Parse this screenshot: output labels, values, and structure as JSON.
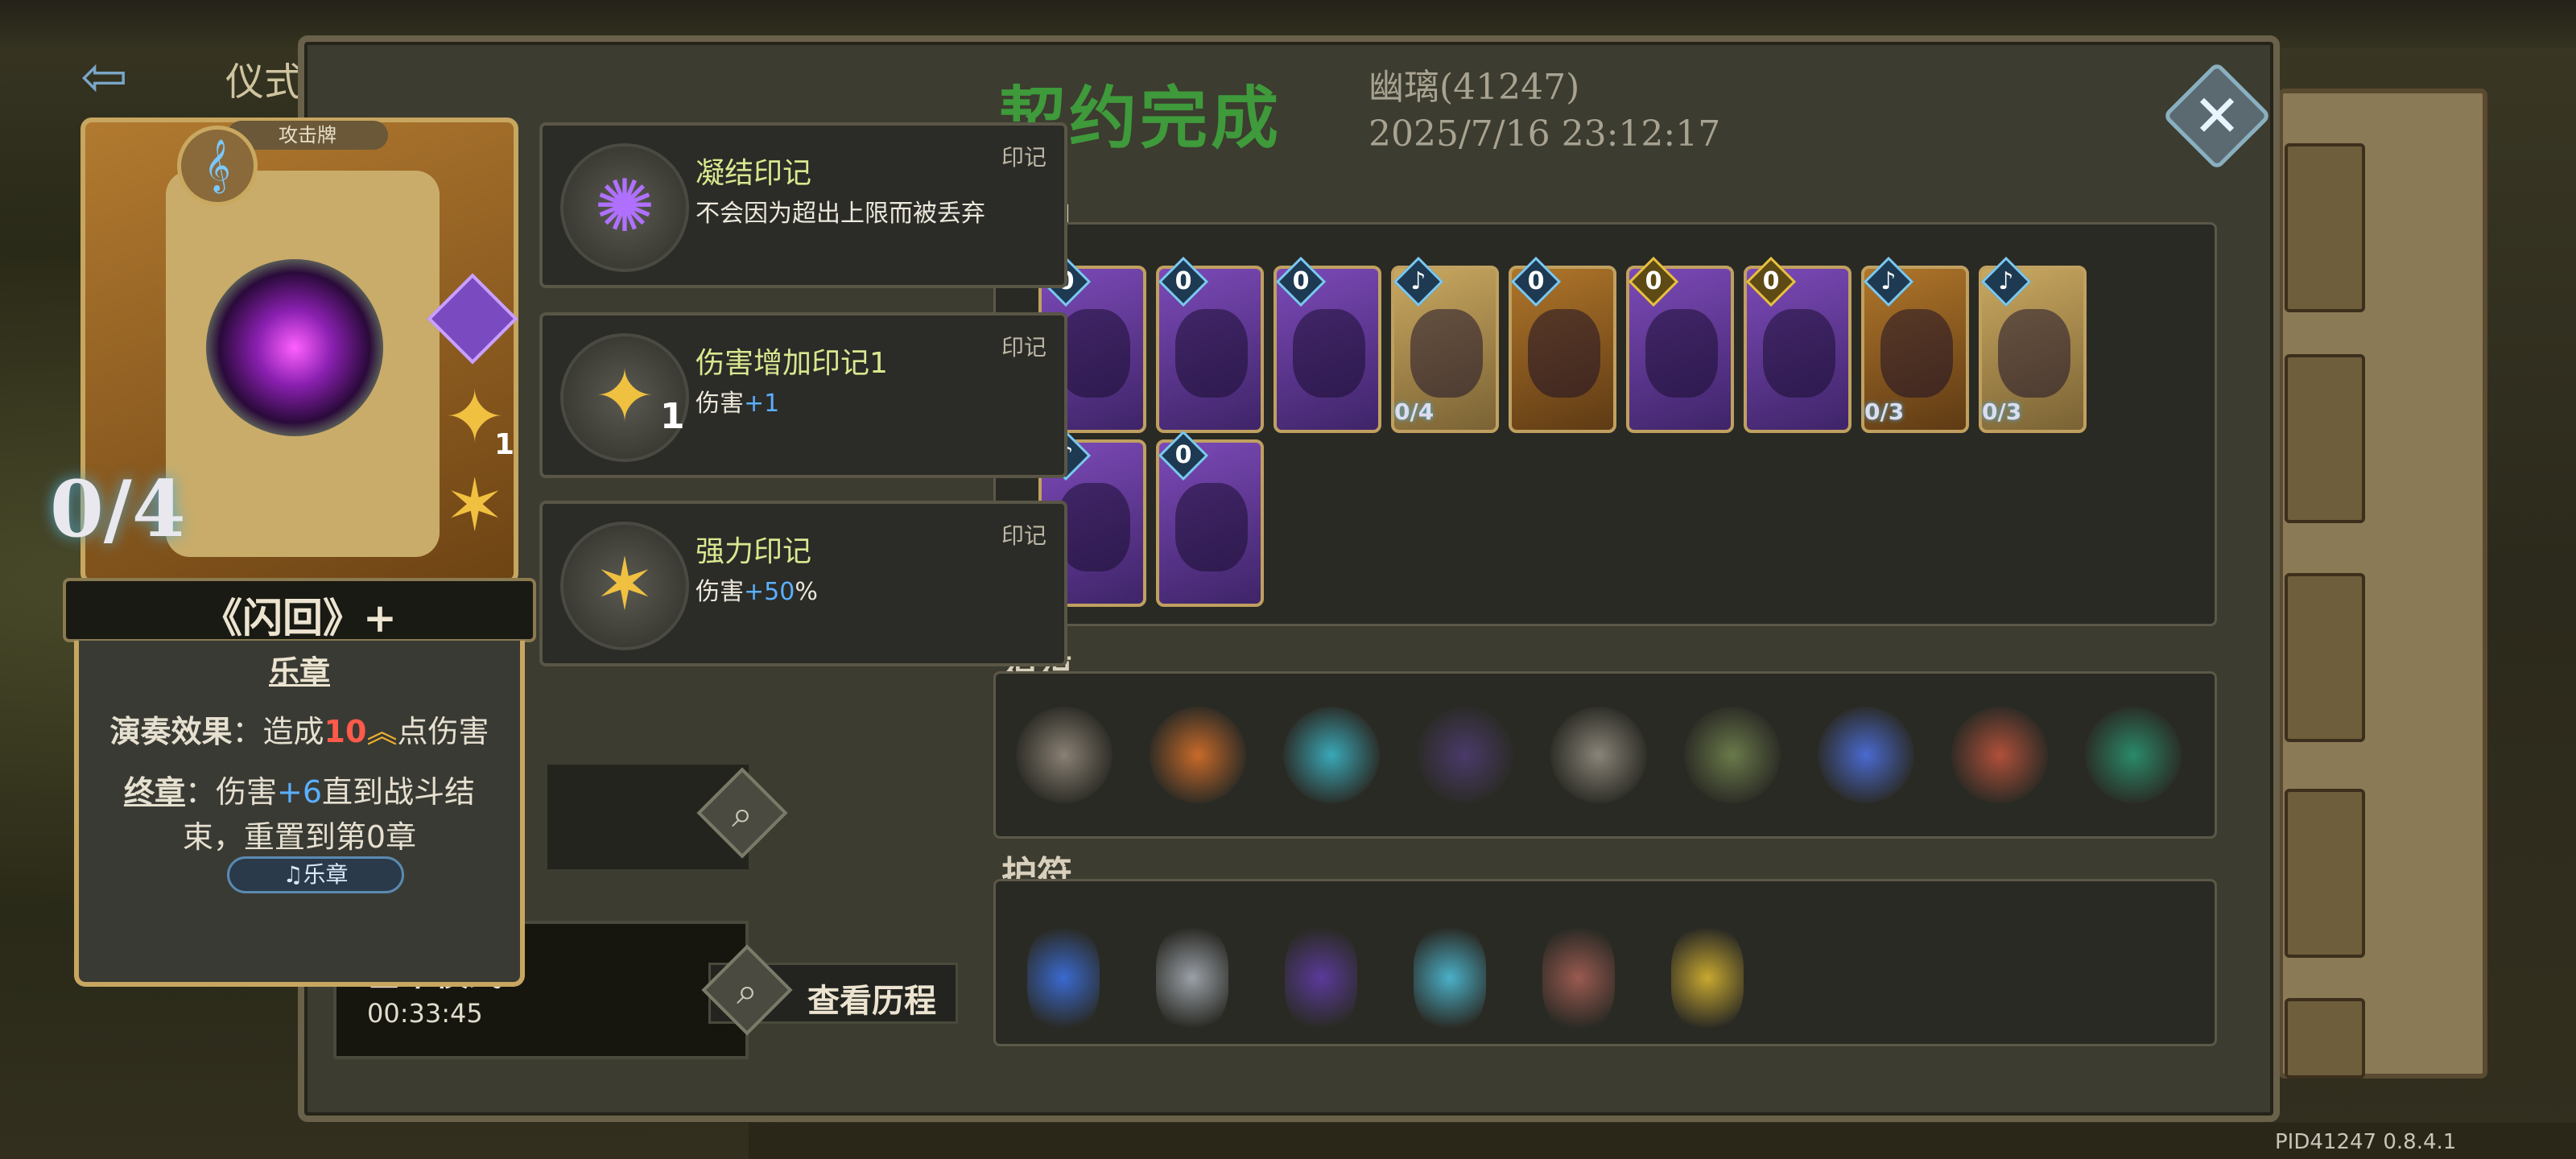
{
  "background": {
    "title": "仪式"
  },
  "dialog": {
    "title": "契约完成",
    "player_name": "幽璃(41247)",
    "timestamp": "2025/7/16 23:12:17",
    "close_icon": "close-icon"
  },
  "sections": {
    "deck_label": "卡组",
    "blessing_label": "祝福",
    "amulet_label": "护符"
  },
  "deck": [
    {
      "cost": "0",
      "color": "purple",
      "cost_type": "blue",
      "progress": ""
    },
    {
      "cost": "0",
      "color": "purple",
      "cost_type": "blue",
      "progress": ""
    },
    {
      "cost": "0",
      "color": "purple",
      "cost_type": "blue",
      "progress": ""
    },
    {
      "cost": "",
      "color": "gold",
      "cost_type": "blue",
      "progress": "0/4"
    },
    {
      "cost": "0",
      "color": "orange",
      "cost_type": "blue",
      "progress": ""
    },
    {
      "cost": "0",
      "color": "purple",
      "cost_type": "gold",
      "progress": ""
    },
    {
      "cost": "0",
      "color": "purple",
      "cost_type": "gold",
      "progress": ""
    },
    {
      "cost": "",
      "color": "orange",
      "cost_type": "blue",
      "progress": "0/3"
    },
    {
      "cost": "",
      "color": "gold",
      "cost_type": "blue",
      "progress": "0/3"
    },
    {
      "cost": "",
      "color": "purple",
      "cost_type": "blue",
      "progress": ""
    },
    {
      "cost": "0",
      "color": "purple",
      "cost_type": "blue",
      "progress": ""
    }
  ],
  "blessings": [
    {
      "icon": "cards-icon",
      "color": "#8a8074"
    },
    {
      "icon": "dagger-icon",
      "color": "#c86a2a"
    },
    {
      "icon": "blue-card-icon",
      "color": "#3aa8b8"
    },
    {
      "icon": "beast-icon",
      "color": "#4a3a6a"
    },
    {
      "icon": "crystal-icon",
      "color": "#8a8478"
    },
    {
      "icon": "meditation-icon",
      "color": "#6a7a4a"
    },
    {
      "icon": "prism-icon",
      "color": "#4a6ad0"
    },
    {
      "icon": "brain-upgrade-icon",
      "color": "#b0503a"
    },
    {
      "icon": "sitting-figure-icon",
      "color": "#2a8a6a"
    }
  ],
  "amulets": [
    {
      "icon": "blue-crystal-amulet-icon",
      "color": "#3a6ad0"
    },
    {
      "icon": "silver-stone-amulet-icon",
      "color": "#9aa0a8"
    },
    {
      "icon": "purple-gem-amulet-icon",
      "color": "#5a3a9a"
    },
    {
      "icon": "lantern-amulet-icon",
      "color": "#4ab0c8"
    },
    {
      "icon": "red-helmet-amulet-icon",
      "color": "#9a5a50"
    },
    {
      "icon": "golden-key-amulet-icon",
      "color": "#c8a830"
    }
  ],
  "selected_card": {
    "type_label": "攻击牌",
    "progress": "0/4",
    "name": "《闪回》+",
    "mark_count": "1",
    "keyword": "乐章",
    "effect_label": "演奏效果",
    "effect_prefix": "：造成",
    "effect_value": "10",
    "effect_suffix": "点伤害",
    "finale_label": "终章",
    "finale_prefix": "：伤害",
    "finale_value": "+6",
    "finale_suffix": "直到战斗结束，重置到第0章",
    "tag_label": "乐章"
  },
  "tooltips": [
    {
      "title": "凝结印记",
      "desc": "不会因为超出上限而被丢弃",
      "tag": "印记",
      "icon": "brain-sigil-icon",
      "num": "",
      "desc_prefix": "",
      "desc_value": "",
      "desc_suffix": ""
    },
    {
      "title": "伤害增加印记1",
      "desc": "",
      "tag": "印记",
      "icon": "flame-sigil-icon",
      "num": "1",
      "desc_prefix": "伤害",
      "desc_value": "+1",
      "desc_suffix": ""
    },
    {
      "title": "强力印记",
      "desc": "",
      "tag": "印记",
      "icon": "spark-sigil-icon",
      "num": "",
      "desc_prefix": "伤害",
      "desc_value": "+50",
      "desc_suffix": "%"
    }
  ],
  "mode": {
    "name": "基本模式",
    "time": "00:33:45"
  },
  "history_button": {
    "label": "查看历程"
  },
  "version": "PID41247  0.8.4.1"
}
